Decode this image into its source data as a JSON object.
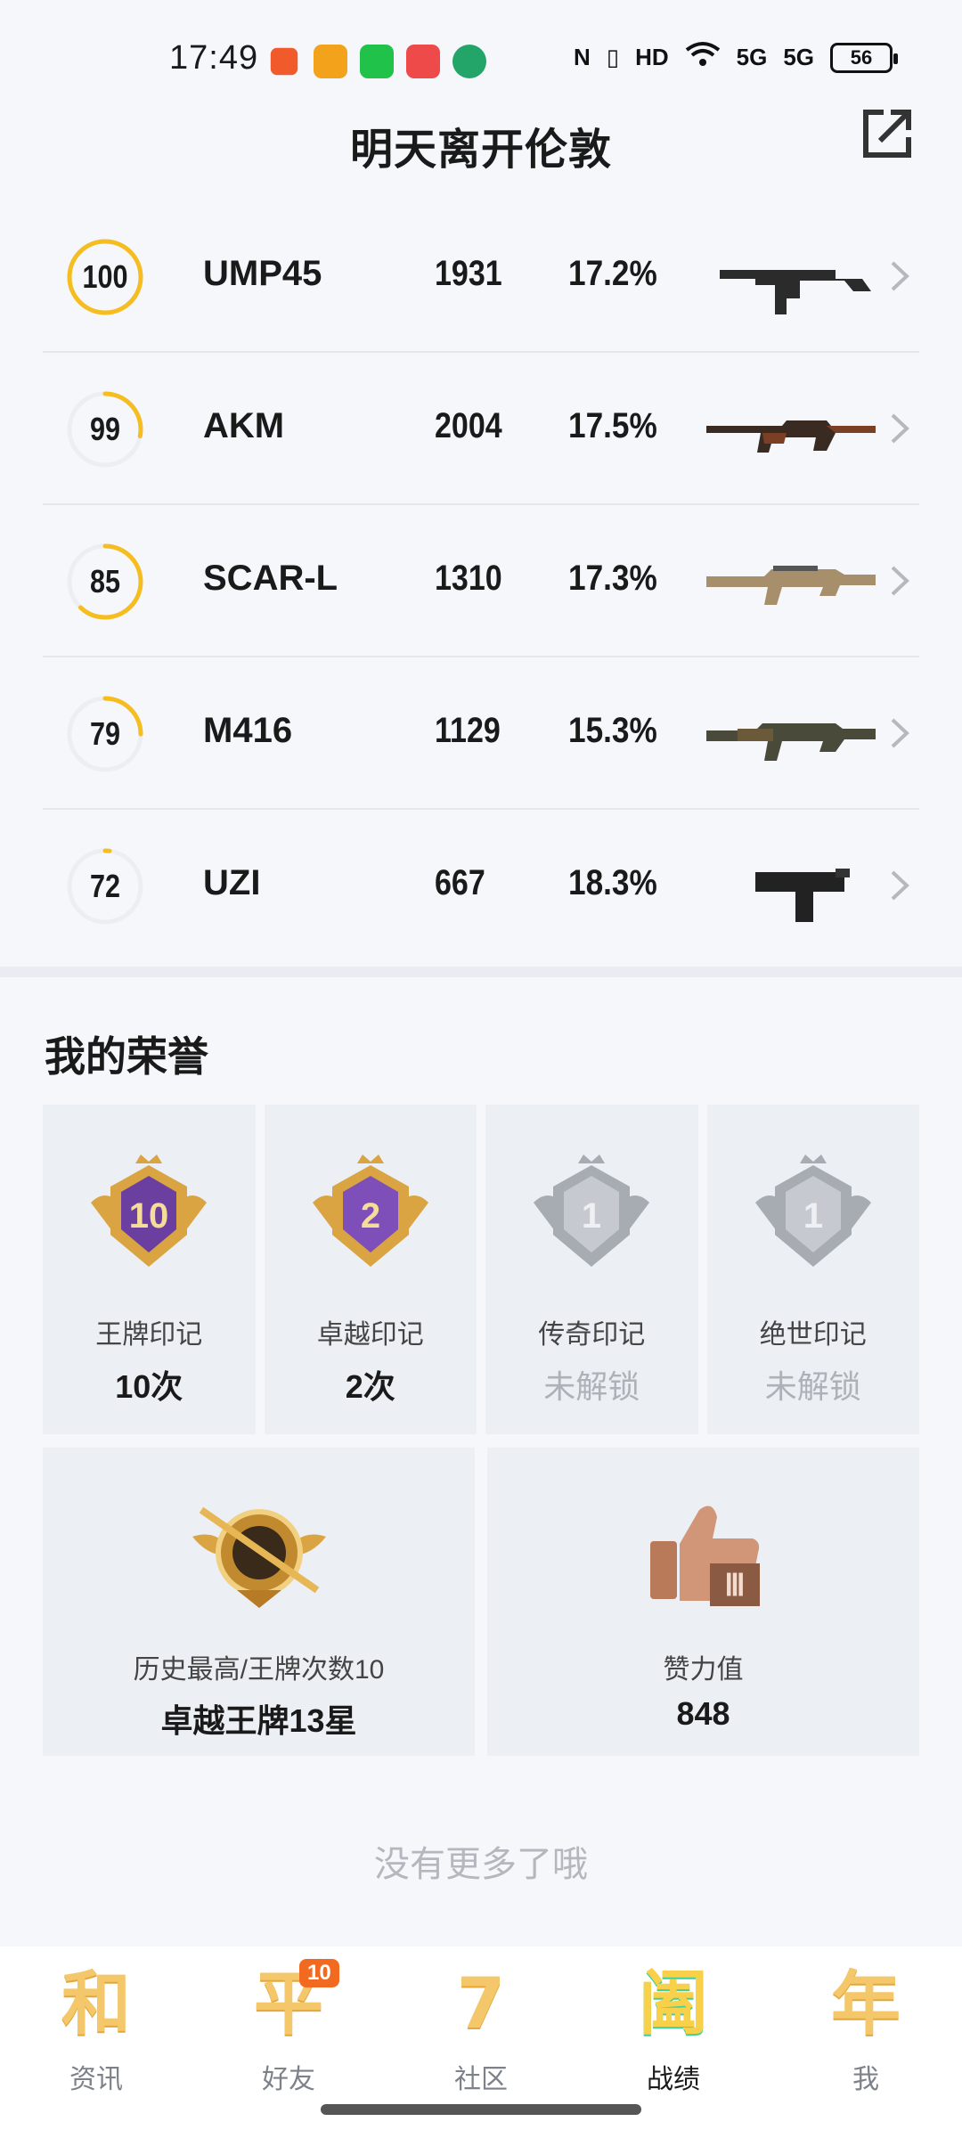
{
  "status_bar": {
    "time": "17:49",
    "network": "HD",
    "sig1": "5G",
    "sig2": "5G",
    "battery": "56"
  },
  "header": {
    "title": "明天离开伦敦"
  },
  "weapons": [
    {
      "level": "100",
      "progress": 1.0,
      "name": "UMP45",
      "count": "1931",
      "percent": "17.2%",
      "image": "smg-ump45"
    },
    {
      "level": "99",
      "progress": 0.28,
      "name": "AKM",
      "count": "2004",
      "percent": "17.5%",
      "image": "rifle-akm"
    },
    {
      "level": "85",
      "progress": 0.62,
      "name": "SCAR-L",
      "count": "1310",
      "percent": "17.3%",
      "image": "rifle-scarl"
    },
    {
      "level": "79",
      "progress": 0.25,
      "name": "M416",
      "count": "1129",
      "percent": "15.3%",
      "image": "rifle-m416"
    },
    {
      "level": "72",
      "progress": 0.02,
      "name": "UZI",
      "count": "667",
      "percent": "18.3%",
      "image": "smg-uzi"
    }
  ],
  "honors": {
    "title": "我的荣誉",
    "marks": [
      {
        "label": "王牌印记",
        "value": "10次",
        "emblem_text": "10",
        "locked": false
      },
      {
        "label": "卓越印记",
        "value": "2次",
        "emblem_text": "2",
        "locked": false
      },
      {
        "label": "传奇印记",
        "value": "未解锁",
        "emblem_text": "1",
        "locked": true
      },
      {
        "label": "绝世印记",
        "value": "未解锁",
        "emblem_text": "1",
        "locked": true
      }
    ],
    "highest": {
      "label": "历史最高/王牌次数10",
      "value": "卓越王牌13星"
    },
    "likes": {
      "label": "赞力值",
      "value": "848"
    }
  },
  "footer_text": "没有更多了哦",
  "tabs": [
    {
      "glyph": "和",
      "label": "资讯"
    },
    {
      "glyph": "平",
      "label": "好友",
      "badge": "10"
    },
    {
      "glyph": "7",
      "label": "社区"
    },
    {
      "glyph": "阖",
      "label": "战绩",
      "active": true
    },
    {
      "glyph": "年",
      "label": "我"
    }
  ],
  "colors": {
    "ring": "#f5bd1f",
    "ring_track": "#eceef2",
    "gold": "#d9a441",
    "purple": "#6b3fa0",
    "silver": "#b9bcc2"
  }
}
